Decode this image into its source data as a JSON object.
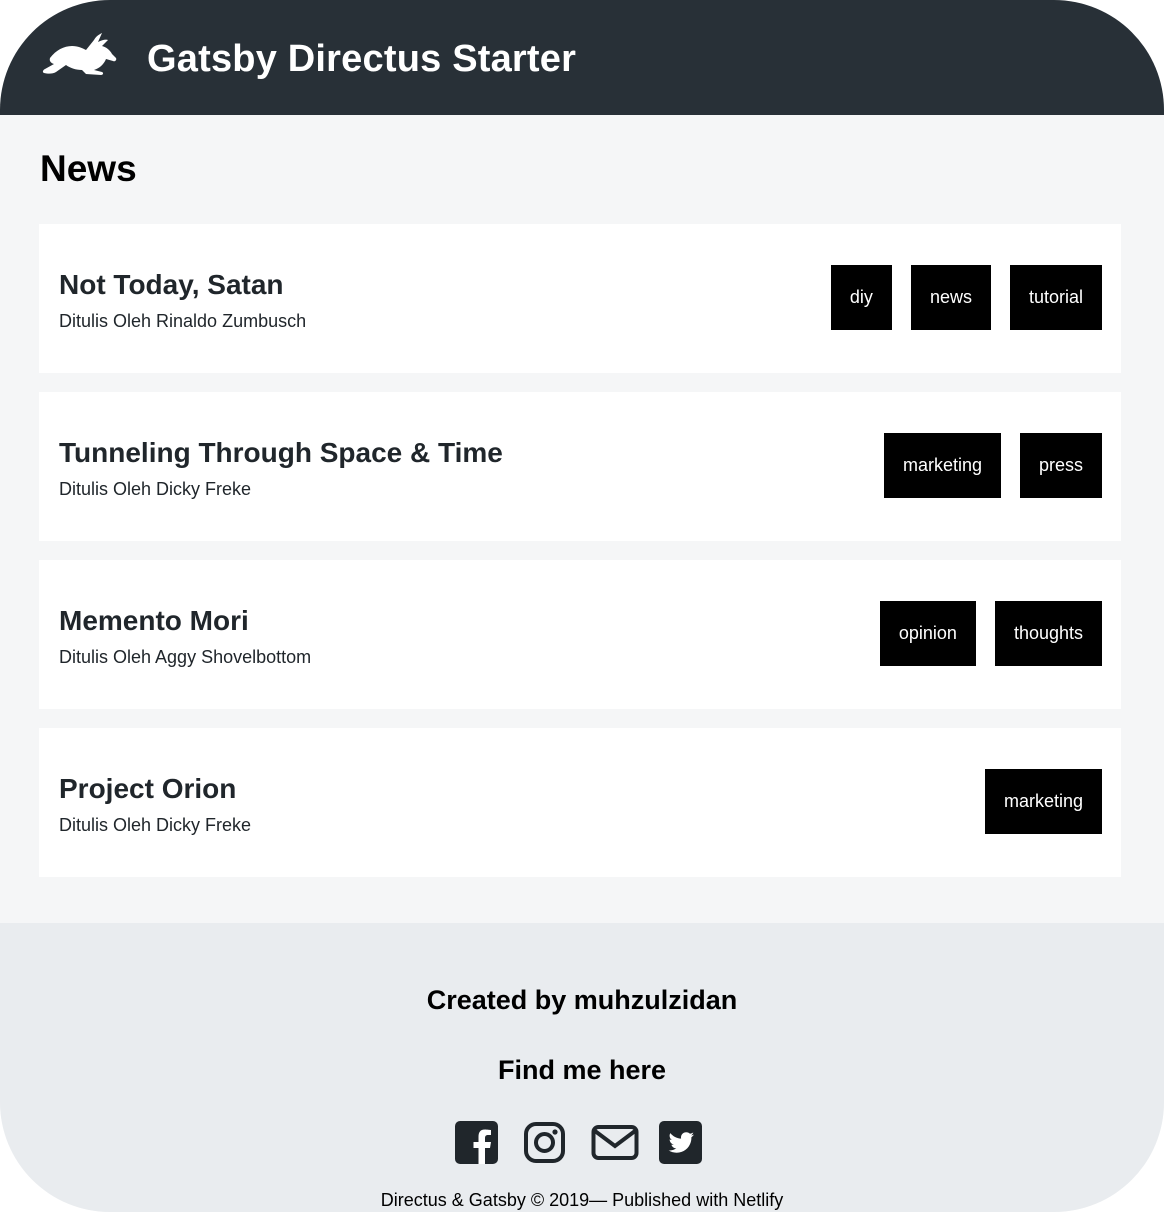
{
  "header": {
    "site_title": "Gatsby Directus Starter",
    "logo_icon": "rabbit-logo-icon"
  },
  "main": {
    "heading": "News",
    "posts": [
      {
        "title": "Not Today, Satan",
        "author_line": "Ditulis Oleh Rinaldo Zumbusch",
        "tags": [
          "diy",
          "news",
          "tutorial"
        ]
      },
      {
        "title": "Tunneling Through Space & Time",
        "author_line": "Ditulis Oleh Dicky Freke",
        "tags": [
          "marketing",
          "press"
        ]
      },
      {
        "title": "Memento Mori",
        "author_line": "Ditulis Oleh Aggy Shovelbottom",
        "tags": [
          "opinion",
          "thoughts"
        ]
      },
      {
        "title": "Project Orion",
        "author_line": "Ditulis Oleh Dicky Freke",
        "tags": [
          "marketing"
        ]
      }
    ]
  },
  "footer": {
    "created_by": "Created by muhzulzidan",
    "find_me": "Find me here",
    "social_icons": [
      "facebook-icon",
      "instagram-icon",
      "email-icon",
      "twitter-icon"
    ],
    "copyright": "Directus & Gatsby © 2019— Published with Netlify"
  },
  "colors": {
    "header_bg": "#283037",
    "page_bg": "#f5f6f7",
    "card_bg": "#ffffff",
    "tag_bg": "#000000",
    "tag_text": "#ffffff",
    "footer_bg": "#e9ecef",
    "icon_color": "#20262b"
  }
}
